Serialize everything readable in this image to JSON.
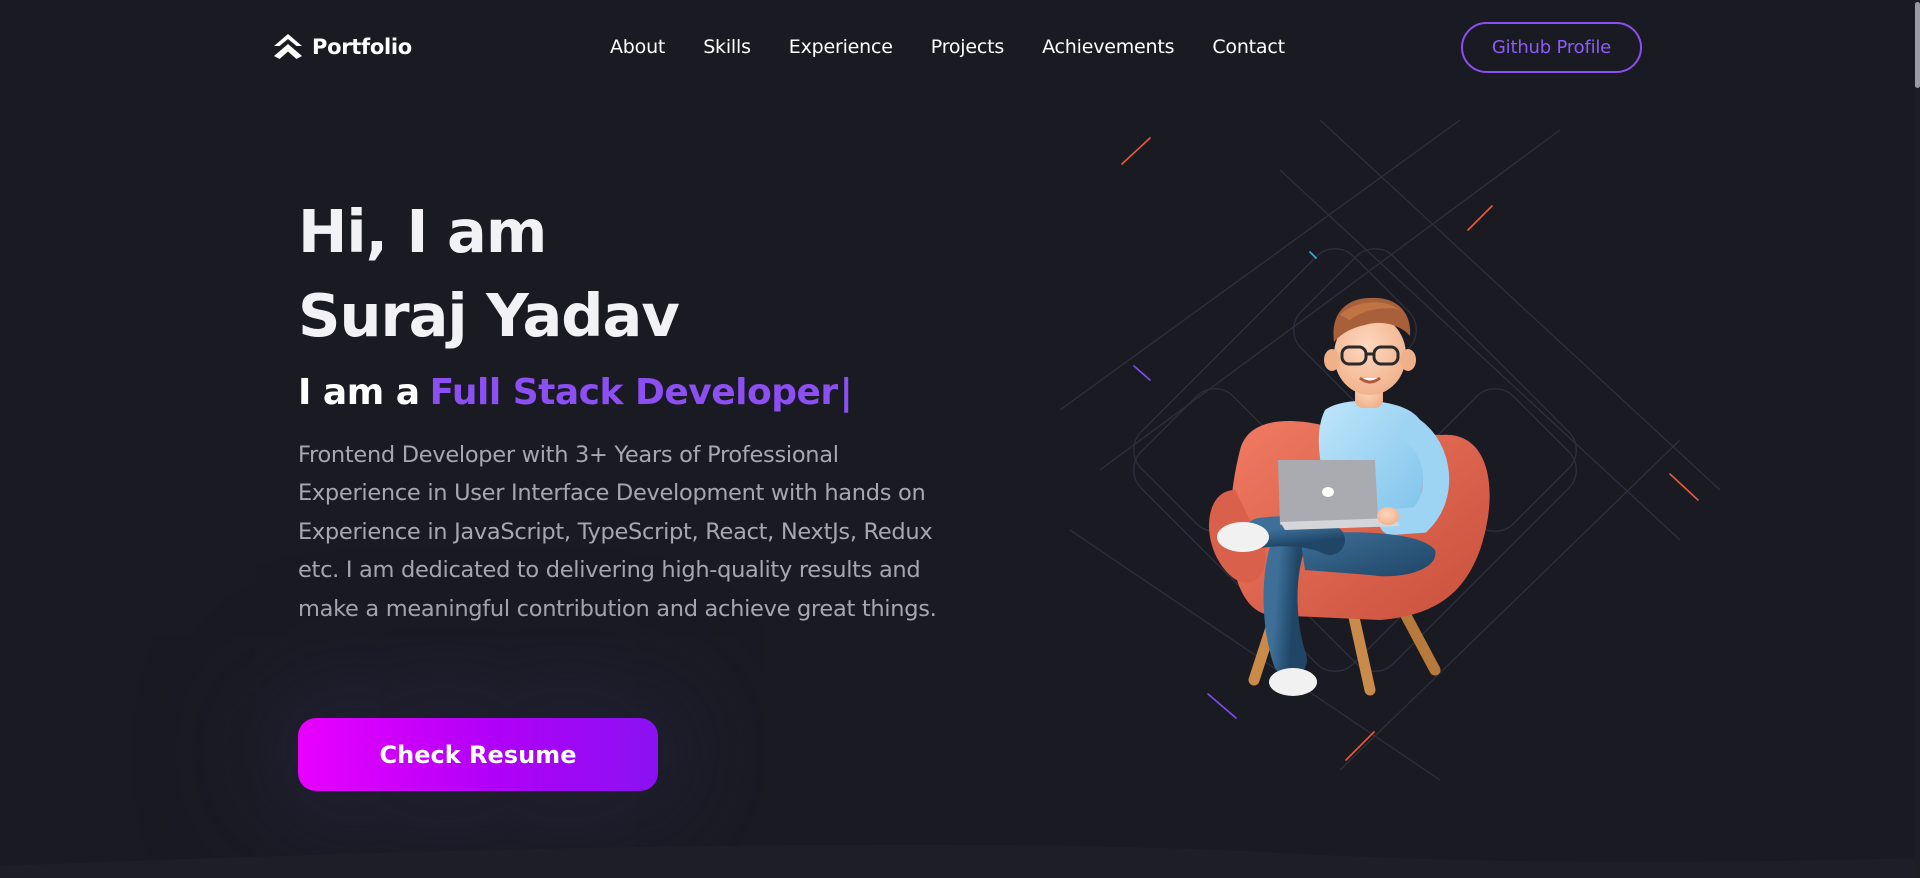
{
  "brand": {
    "name": "Portfolio",
    "logo_icon": "house-chevron-icon"
  },
  "nav": {
    "items": [
      {
        "label": "About"
      },
      {
        "label": "Skills"
      },
      {
        "label": "Experience"
      },
      {
        "label": "Projects"
      },
      {
        "label": "Achievements"
      },
      {
        "label": "Contact"
      }
    ],
    "github_button": "Github Profile"
  },
  "hero": {
    "greeting_line1": "Hi, I am",
    "greeting_line2": "Suraj Yadav",
    "role_prefix": "I am a",
    "role_value": "Full Stack Developer",
    "role_cursor": "|",
    "bio": "Frontend Developer with 3+ Years of Professional Experience in User Interface Development with hands on Experience in JavaScript, TypeScript, React, NextJs, Redux etc. I am dedicated to delivering high-quality results and make a meaningful contribution and achieve great things.",
    "cta_button": "Check Resume"
  },
  "colors": {
    "background": "#1a1a23",
    "accent": "#8b4ff2",
    "cta_gradient_start": "#e900ff",
    "cta_gradient_end": "#8a12f2",
    "text_primary": "#f2f2f6",
    "text_secondary": "#a7a7b2"
  }
}
